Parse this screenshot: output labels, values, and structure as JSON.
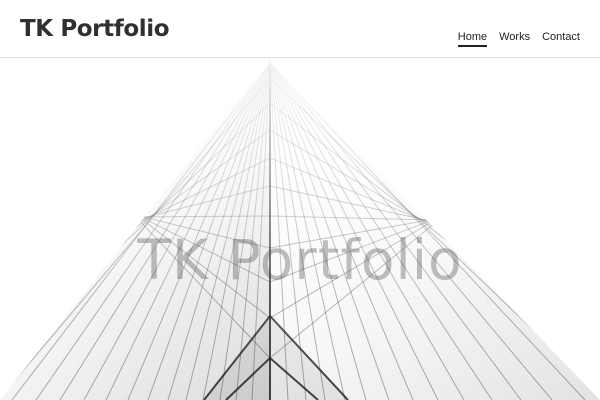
{
  "site": {
    "title": "TK Portfolio"
  },
  "navigation": {
    "items": [
      {
        "label": "Home",
        "active": true
      },
      {
        "label": "Works",
        "active": false
      },
      {
        "label": "Contact",
        "active": false
      }
    ]
  },
  "hero": {
    "title": "TK Portfolio",
    "image_subject": "white high-rise building facade with grid windows"
  },
  "colors": {
    "header_background": "#ffffff",
    "title_text": "#303030",
    "nav_text": "#222222",
    "header_border": "#dcdcdc",
    "hero_overlay_text": "rgba(70, 70, 70, 0.34)"
  }
}
